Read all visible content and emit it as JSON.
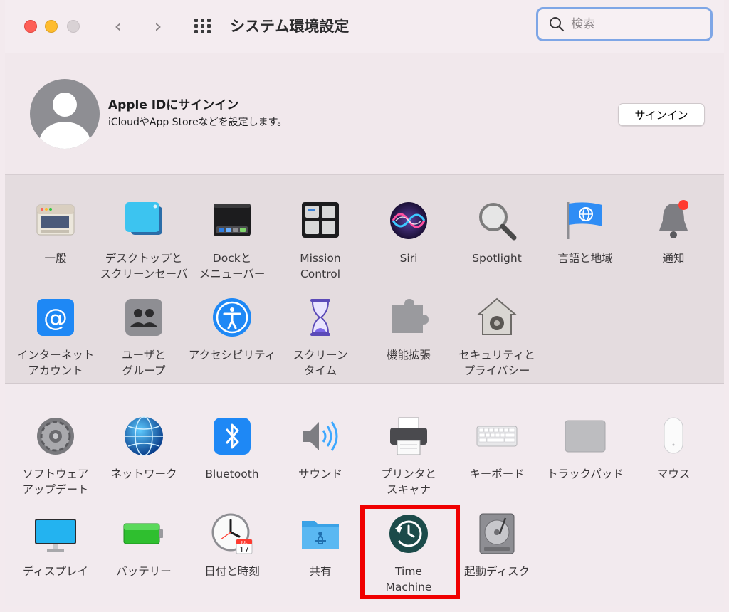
{
  "window": {
    "title": "システム環境設定"
  },
  "search": {
    "placeholder": "検索"
  },
  "apple_id": {
    "title": "Apple IDにサインイン",
    "subtitle": "iCloudやApp Storeなどを設定します。",
    "signin_label": "サインイン"
  },
  "section1": {
    "items": [
      {
        "label": "一般",
        "icon": "general-icon"
      },
      {
        "label": "デスクトップと\nスクリーンセーバ",
        "icon": "desktop-screensaver-icon"
      },
      {
        "label": "Dockと\nメニューバー",
        "icon": "dock-menubar-icon"
      },
      {
        "label": "Mission\nControl",
        "icon": "mission-control-icon"
      },
      {
        "label": "Siri",
        "icon": "siri-icon"
      },
      {
        "label": "Spotlight",
        "icon": "spotlight-icon"
      },
      {
        "label": "言語と地域",
        "icon": "language-region-icon"
      },
      {
        "label": "通知",
        "icon": "notifications-icon"
      },
      {
        "label": "インターネット\nアカウント",
        "icon": "internet-accounts-icon"
      },
      {
        "label": "ユーザと\nグループ",
        "icon": "users-groups-icon"
      },
      {
        "label": "アクセシビリティ",
        "icon": "accessibility-icon"
      },
      {
        "label": "スクリーン\nタイム",
        "icon": "screen-time-icon"
      },
      {
        "label": "機能拡張",
        "icon": "extensions-icon"
      },
      {
        "label": "セキュリティと\nプライバシー",
        "icon": "security-privacy-icon"
      }
    ]
  },
  "section2": {
    "items": [
      {
        "label": "ソフトウェア\nアップデート",
        "icon": "software-update-icon"
      },
      {
        "label": "ネットワーク",
        "icon": "network-icon"
      },
      {
        "label": "Bluetooth",
        "icon": "bluetooth-icon"
      },
      {
        "label": "サウンド",
        "icon": "sound-icon"
      },
      {
        "label": "プリンタと\nスキャナ",
        "icon": "printers-scanners-icon"
      },
      {
        "label": "キーボード",
        "icon": "keyboard-icon"
      },
      {
        "label": "トラックパッド",
        "icon": "trackpad-icon"
      },
      {
        "label": "マウス",
        "icon": "mouse-icon"
      },
      {
        "label": "ディスプレイ",
        "icon": "displays-icon"
      },
      {
        "label": "バッテリー",
        "icon": "battery-icon"
      },
      {
        "label": "日付と時刻",
        "icon": "date-time-icon"
      },
      {
        "label": "共有",
        "icon": "sharing-icon"
      },
      {
        "label": "Time\nMachine",
        "icon": "time-machine-icon"
      },
      {
        "label": "起動ディスク",
        "icon": "startup-disk-icon"
      }
    ]
  },
  "calendar_badge": {
    "month": "JUL",
    "day": "17"
  },
  "colors": {
    "highlight": "#f00000",
    "accent_blue": "#1e88f5",
    "search_focus": "#7ea6e6"
  }
}
